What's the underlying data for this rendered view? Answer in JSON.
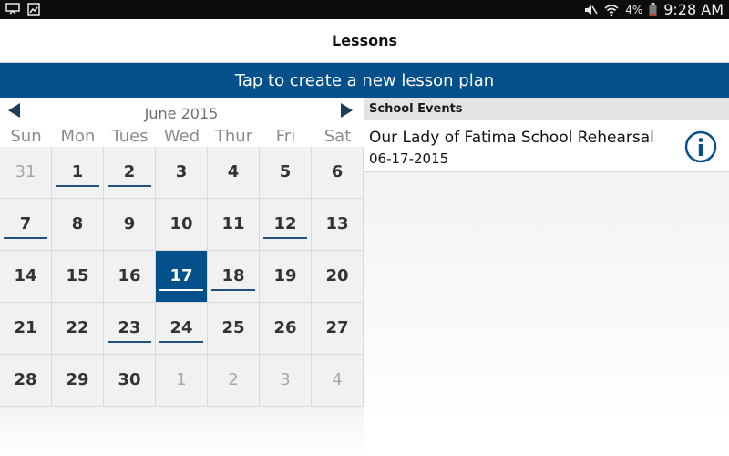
{
  "status_bar": {
    "time": "9:28 AM",
    "battery_percent": "4%",
    "icons": [
      "cast-icon",
      "gallery-icon",
      "mute-icon",
      "wifi-icon",
      "battery-icon"
    ]
  },
  "header": {
    "title": "Lessons"
  },
  "banner": {
    "label": "Tap to create a new lesson plan"
  },
  "calendar": {
    "month_label": "June 2015",
    "weekdays": [
      "Sun",
      "Mon",
      "Tues",
      "Wed",
      "Thur",
      "Fri",
      "Sat"
    ],
    "days": [
      {
        "label": "31",
        "other_month": true,
        "marker": false,
        "selected": false
      },
      {
        "label": "1",
        "other_month": false,
        "marker": true,
        "selected": false
      },
      {
        "label": "2",
        "other_month": false,
        "marker": true,
        "selected": false
      },
      {
        "label": "3",
        "other_month": false,
        "marker": false,
        "selected": false
      },
      {
        "label": "4",
        "other_month": false,
        "marker": false,
        "selected": false
      },
      {
        "label": "5",
        "other_month": false,
        "marker": false,
        "selected": false
      },
      {
        "label": "6",
        "other_month": false,
        "marker": false,
        "selected": false
      },
      {
        "label": "7",
        "other_month": false,
        "marker": true,
        "selected": false
      },
      {
        "label": "8",
        "other_month": false,
        "marker": false,
        "selected": false
      },
      {
        "label": "9",
        "other_month": false,
        "marker": false,
        "selected": false
      },
      {
        "label": "10",
        "other_month": false,
        "marker": false,
        "selected": false
      },
      {
        "label": "11",
        "other_month": false,
        "marker": false,
        "selected": false
      },
      {
        "label": "12",
        "other_month": false,
        "marker": true,
        "selected": false
      },
      {
        "label": "13",
        "other_month": false,
        "marker": false,
        "selected": false
      },
      {
        "label": "14",
        "other_month": false,
        "marker": false,
        "selected": false
      },
      {
        "label": "15",
        "other_month": false,
        "marker": false,
        "selected": false
      },
      {
        "label": "16",
        "other_month": false,
        "marker": false,
        "selected": false
      },
      {
        "label": "17",
        "other_month": false,
        "marker": true,
        "selected": true
      },
      {
        "label": "18",
        "other_month": false,
        "marker": true,
        "selected": false
      },
      {
        "label": "19",
        "other_month": false,
        "marker": false,
        "selected": false
      },
      {
        "label": "20",
        "other_month": false,
        "marker": false,
        "selected": false
      },
      {
        "label": "21",
        "other_month": false,
        "marker": false,
        "selected": false
      },
      {
        "label": "22",
        "other_month": false,
        "marker": false,
        "selected": false
      },
      {
        "label": "23",
        "other_month": false,
        "marker": true,
        "selected": false
      },
      {
        "label": "24",
        "other_month": false,
        "marker": true,
        "selected": false
      },
      {
        "label": "25",
        "other_month": false,
        "marker": false,
        "selected": false
      },
      {
        "label": "26",
        "other_month": false,
        "marker": false,
        "selected": false
      },
      {
        "label": "27",
        "other_month": false,
        "marker": false,
        "selected": false
      },
      {
        "label": "28",
        "other_month": false,
        "marker": false,
        "selected": false
      },
      {
        "label": "29",
        "other_month": false,
        "marker": false,
        "selected": false
      },
      {
        "label": "30",
        "other_month": false,
        "marker": false,
        "selected": false
      },
      {
        "label": "1",
        "other_month": true,
        "marker": false,
        "selected": false
      },
      {
        "label": "2",
        "other_month": true,
        "marker": false,
        "selected": false
      },
      {
        "label": "3",
        "other_month": true,
        "marker": false,
        "selected": false
      },
      {
        "label": "4",
        "other_month": true,
        "marker": false,
        "selected": false
      }
    ]
  },
  "events": {
    "header": "School Events",
    "items": [
      {
        "title": "Our Lady of Fatima School Rehearsal",
        "date": "06-17-2015"
      }
    ]
  },
  "colors": {
    "accent": "#04508a",
    "marker": "#1f4f7e",
    "status_bar": "#0d0d0d"
  }
}
